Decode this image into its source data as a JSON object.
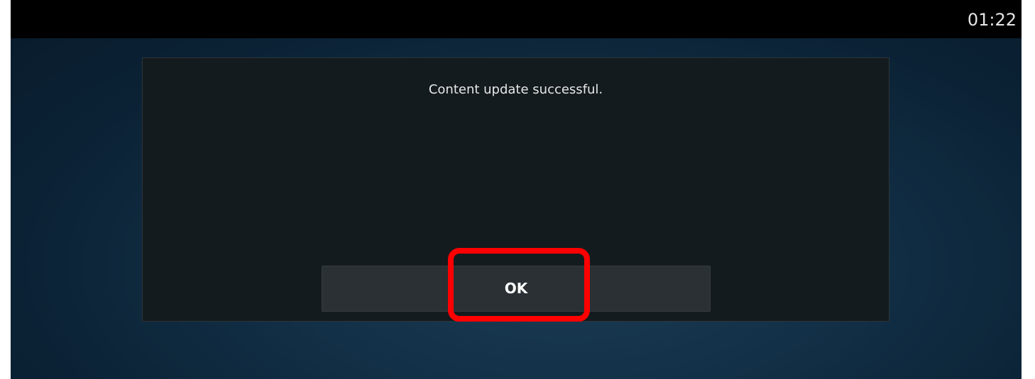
{
  "status_bar": {
    "clock": "01:22"
  },
  "dialog": {
    "message": "Content update successful.",
    "ok_label": "OK"
  },
  "colors": {
    "status_bar_bg": "#000000",
    "dialog_bg": "#141b1e",
    "button_bg": "#2a3033",
    "highlight_border": "#ff0000"
  }
}
